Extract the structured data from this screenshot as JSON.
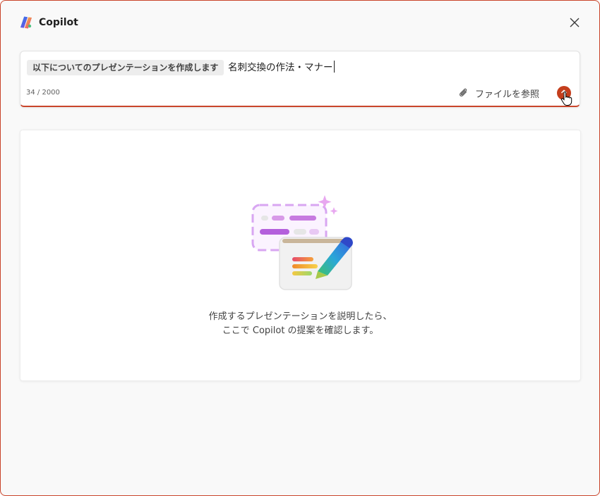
{
  "header": {
    "app_title": "Copilot",
    "logo_icon": "copilot-logo-icon",
    "close_icon": "close-icon"
  },
  "composer": {
    "prompt_prefix": "以下についてのプレゼンテーションを作成します",
    "input_value": "名刺交換の作法・マナー",
    "char_count": "34 / 2000",
    "attach_label": "ファイルを参照",
    "attach_icon": "paperclip-icon",
    "send_icon": "send-arrow-icon"
  },
  "empty_state": {
    "line1": "作成するプレゼンテーションを説明したら、",
    "line2": "ここで Copilot の提案を確認します。",
    "illustration_icon": "presentation-pen-illustration"
  },
  "colors": {
    "accent": "#c43e1c",
    "border_accent": "#c9442a",
    "background": "#f9f9f9"
  }
}
